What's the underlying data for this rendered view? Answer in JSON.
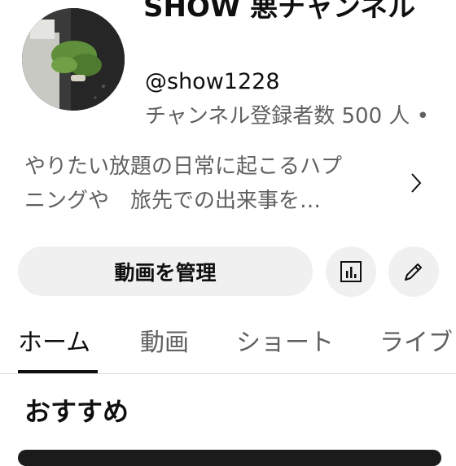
{
  "channel": {
    "title": "SHOW 悪チャンネル",
    "handle": "@show1228",
    "subscribers": "チャンネル登録者数 500 人 •",
    "description_lines": [
      "やりたい放題の日常に起こるハプ",
      "ニングや　旅先での出来事を…"
    ]
  },
  "actions": {
    "manage_videos": "動画を管理"
  },
  "tabs": [
    {
      "label": "ホーム",
      "active": true
    },
    {
      "label": "動画",
      "active": false
    },
    {
      "label": "ショート",
      "active": false
    },
    {
      "label": "ライブ",
      "active": false
    }
  ],
  "sections": {
    "recommended": "おすすめ"
  },
  "icons": {
    "analytics": "analytics-icon",
    "edit": "pencil-icon",
    "chevron": "chevron-right-icon"
  }
}
